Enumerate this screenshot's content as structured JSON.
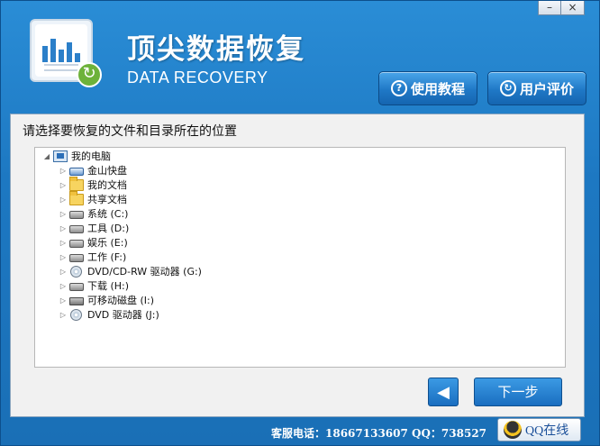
{
  "window": {
    "minimize_label": "–",
    "close_label": "×"
  },
  "header": {
    "title": "顶尖数据恢复",
    "subtitle": "DATA RECOVERY",
    "tutorial_icon": "?",
    "tutorial_label": "使用教程",
    "review_icon": "↻",
    "review_label": "用户评价"
  },
  "main": {
    "heading": "请选择要恢复的文件和目录所在的位置",
    "tree": {
      "root": {
        "label": "我的电脑",
        "expander": "◢",
        "icon": "computer-icon"
      },
      "children": [
        {
          "label": "金山快盘",
          "expander": "▷",
          "icon": "cloud-drive-icon"
        },
        {
          "label": "我的文档",
          "expander": "▷",
          "icon": "folder-icon"
        },
        {
          "label": "共享文档",
          "expander": "▷",
          "icon": "folder-icon"
        },
        {
          "label": "系统 (C:)",
          "expander": "▷",
          "icon": "drive-icon"
        },
        {
          "label": "工具 (D:)",
          "expander": "▷",
          "icon": "drive-icon"
        },
        {
          "label": "娱乐 (E:)",
          "expander": "▷",
          "icon": "drive-icon"
        },
        {
          "label": "工作 (F:)",
          "expander": "▷",
          "icon": "drive-icon"
        },
        {
          "label": "DVD/CD-RW 驱动器 (G:)",
          "expander": "▷",
          "icon": "cd-drive-icon"
        },
        {
          "label": "下载 (H:)",
          "expander": "▷",
          "icon": "drive-icon"
        },
        {
          "label": "可移动磁盘 (I:)",
          "expander": "▷",
          "icon": "usb-drive-icon"
        },
        {
          "label": "DVD 驱动器 (J:)",
          "expander": "▷",
          "icon": "cd-drive-icon"
        }
      ]
    }
  },
  "nav": {
    "back_label": "◀",
    "next_label": "下一步"
  },
  "footer": {
    "support_text": "客服电话：18667133607 QQ：738527",
    "qq_label": "QQ在线"
  }
}
